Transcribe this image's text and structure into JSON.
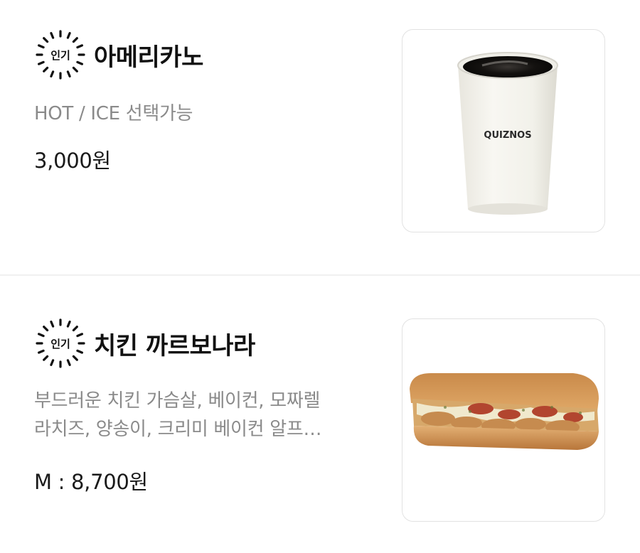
{
  "items": [
    {
      "badge": "인기",
      "title": "아메리카노",
      "description_lines": [
        "HOT / ICE 선택가능"
      ],
      "price": "3,000원",
      "image_icon": "coffee-cup-icon",
      "cup_brand": "QUIZNOS"
    },
    {
      "badge": "인기",
      "title": "치킨 까르보나라",
      "description_lines": [
        "부드러운 치킨 가슴살, 베이컨, 모짜렐",
        "라치즈, 양송이, 크리미 베이컨 알프…"
      ],
      "price": "M : 8,700원",
      "image_icon": "sandwich-icon"
    }
  ]
}
